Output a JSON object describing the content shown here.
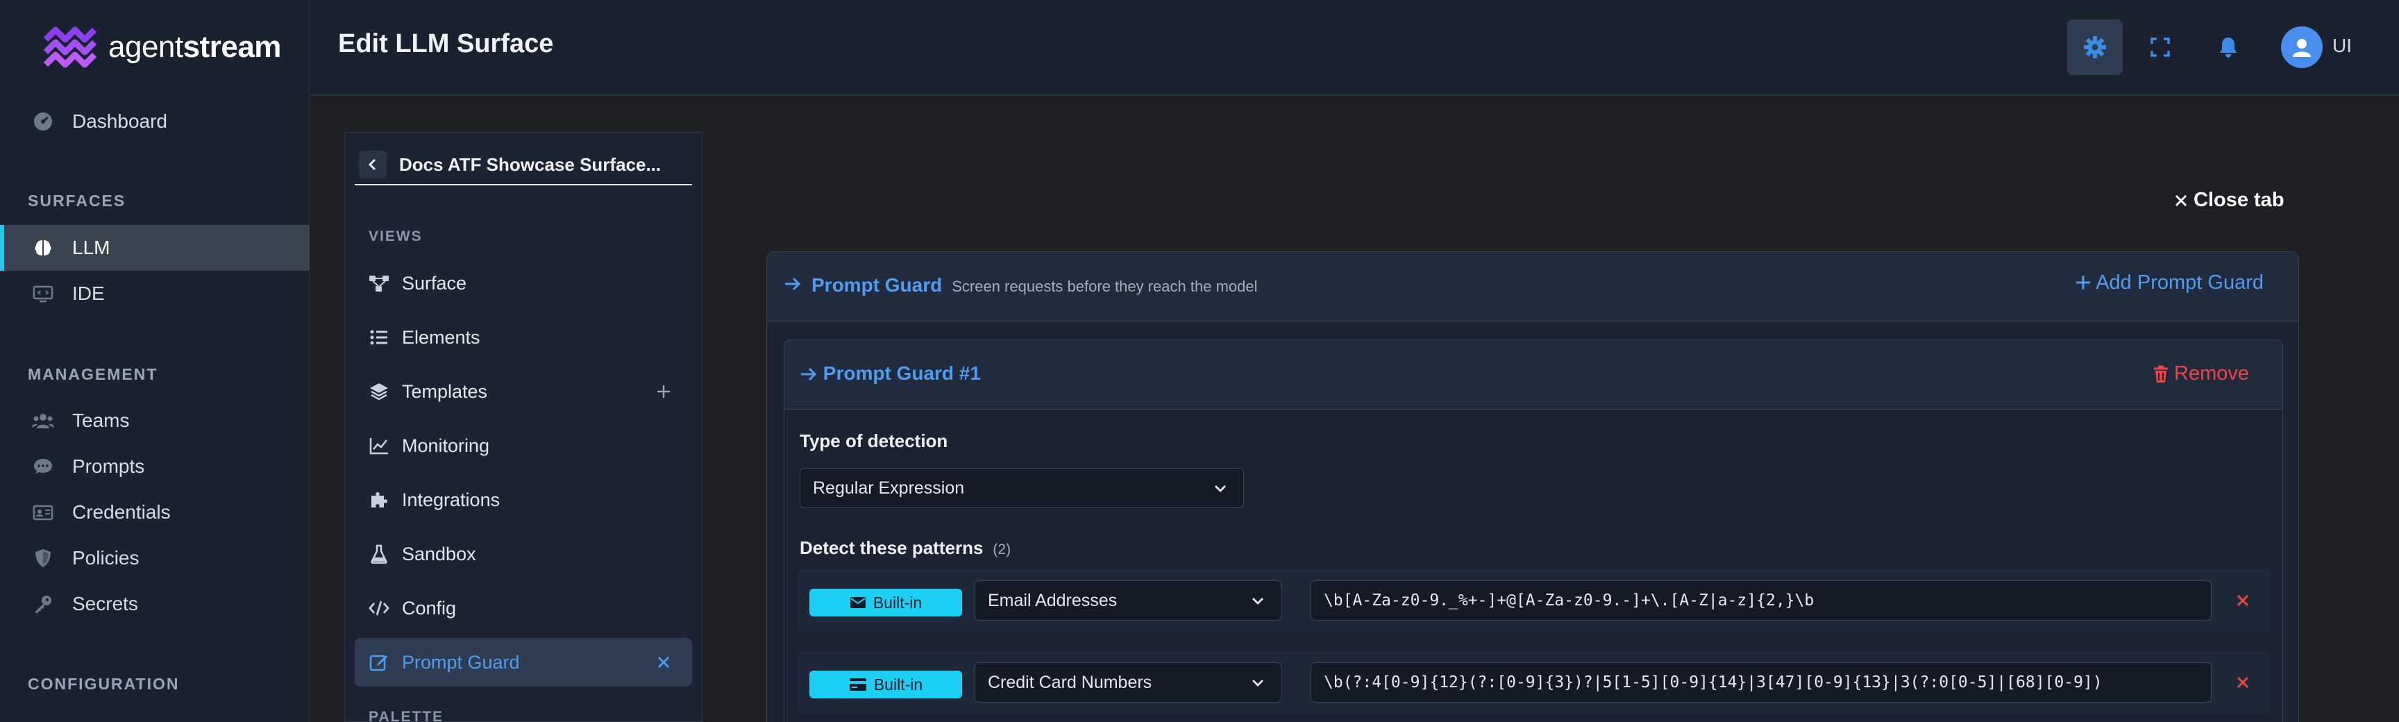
{
  "app": {
    "logo_text_light": "agent",
    "logo_text_bold": "stream",
    "page_title": "Edit LLM Surface",
    "accent": "#4f9cf0",
    "highlight": "#1bd0f2",
    "danger": "#ef4444",
    "user_initials": "UI"
  },
  "sidebar": {
    "dashboard": "Dashboard",
    "surfaces_head": "SURFACES",
    "llm": "LLM",
    "ide": "IDE",
    "management_head": "MANAGEMENT",
    "teams": "Teams",
    "prompts": "Prompts",
    "credentials": "Credentials",
    "policies": "Policies",
    "secrets": "Secrets",
    "configuration_head": "CONFIGURATION"
  },
  "header_icons": [
    "gear-icon",
    "expand-icon",
    "bell-icon",
    "user-icon"
  ],
  "panel": {
    "title": "Docs ATF Showcase Surface...",
    "views_head": "VIEWS",
    "items": {
      "surface": "Surface",
      "elements": "Elements",
      "templates": "Templates",
      "monitoring": "Monitoring",
      "integrations": "Integrations",
      "sandbox": "Sandbox",
      "config": "Config",
      "prompt_guard": "Prompt Guard"
    },
    "palette_head": "PALETTE"
  },
  "close_tab": "Close tab",
  "guard": {
    "title": "Prompt Guard",
    "subtitle": "Screen requests before they reach the model",
    "add_label": "Add Prompt Guard",
    "item_title": "Prompt Guard #1",
    "remove_label": "Remove",
    "type_label": "Type of detection",
    "type_value": "Regular Expression",
    "patterns_label": "Detect these patterns",
    "patterns_count": "(2)",
    "patterns": [
      {
        "badge": "Built-in",
        "name": "Email Addresses",
        "regex": "\\b[A-Za-z0-9._%+-]+@[A-Za-z0-9.-]+\\.[A-Z|a-z]{2,}\\b"
      },
      {
        "badge": "Built-in",
        "name": "Credit Card Numbers",
        "regex": "\\b(?:4[0-9]{12}(?:[0-9]{3})?|5[1-5][0-9]{14}|3[47][0-9]{13}|3(?:0[0-5]|[68][0-9])"
      }
    ]
  }
}
